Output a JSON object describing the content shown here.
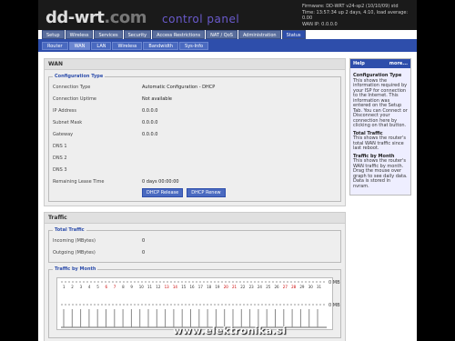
{
  "header": {
    "logo": "dd-wrt",
    "logo_domain": ".com",
    "title": "control panel",
    "info_lines": [
      "Firmware: DD-WRT v24-sp2 (10/10/09) std",
      "Time: 13:57:34 up 2 days, 4:10, load average: 0.00",
      "WAN IP: 0.0.0.0"
    ]
  },
  "main_tabs": [
    "Setup",
    "Wireless",
    "Services",
    "Security",
    "Access Restrictions",
    "NAT / QoS",
    "Administration",
    "Status"
  ],
  "main_tab_active": "Status",
  "sub_tabs": [
    "Router",
    "WAN",
    "LAN",
    "Wireless",
    "Bandwidth",
    "Sys-Info"
  ],
  "sub_tab_active": "WAN",
  "wan": {
    "section_title": "WAN",
    "config_legend": "Configuration Type",
    "rows": [
      {
        "label": "Connection Type",
        "value": "Automatic Configuration - DHCP"
      },
      {
        "label": "Connection Uptime",
        "value": "Not available"
      },
      {
        "label": "IP Address",
        "value": "0.0.0.0"
      },
      {
        "label": "Subnet Mask",
        "value": "0.0.0.0"
      },
      {
        "label": "Gateway",
        "value": "0.0.0.0"
      },
      {
        "label": "DNS 1",
        "value": ""
      },
      {
        "label": "DNS 2",
        "value": ""
      },
      {
        "label": "DNS 3",
        "value": ""
      },
      {
        "label": "Remaining Lease Time",
        "value": "0 days 00:00:00"
      }
    ],
    "buttons": [
      "DHCP Release",
      "DHCP Renew"
    ]
  },
  "traffic": {
    "section_title": "Traffic",
    "total_legend": "Total Traffic",
    "rows": [
      {
        "label": "Incoming (MBytes)",
        "value": "0"
      },
      {
        "label": "Outgoing (MBytes)",
        "value": "0"
      }
    ],
    "by_month_legend": "Traffic by Month",
    "y_labels": [
      "0 MB",
      "0 MB"
    ]
  },
  "help": {
    "title": "Help",
    "more": "more...",
    "items": [
      {
        "heading": "Configuration Type",
        "text": "This shows the information required by your ISP for connection to the Internet. This information was entered on the Setup Tab. You can Connect or Disconnect your connection here by clicking on that button."
      },
      {
        "heading": "Total Traffic",
        "text": "This shows the router's total WAN traffic since last reboot."
      },
      {
        "heading": "Traffic by Month",
        "text": "This shows the router's WAN traffic by month. Drag the mouse over graph to see daily data. Data is stored in nvram."
      }
    ]
  },
  "watermark": "www.elektronika.si",
  "colors": {
    "accent": "#2e4eab",
    "header_bg": "#1a1a1a"
  }
}
